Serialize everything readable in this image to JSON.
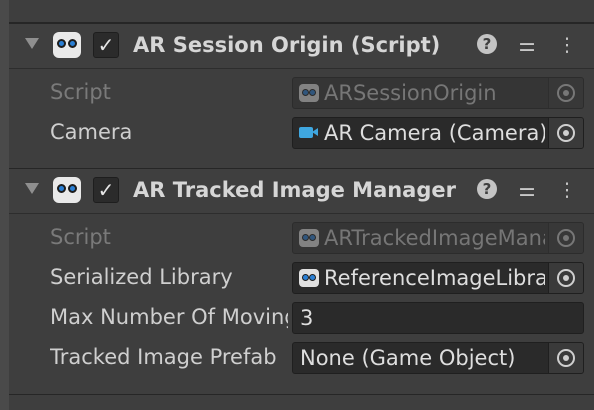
{
  "components": [
    {
      "title": "AR Session Origin (Script)",
      "enabled": true,
      "fields": [
        {
          "label": "Script",
          "value": "ARSessionOrigin",
          "disabled": true,
          "icon": "script-icon"
        },
        {
          "label": "Camera",
          "value": "AR Camera (Camera)",
          "disabled": false,
          "icon": "camera-icon"
        }
      ]
    },
    {
      "title": "AR Tracked Image Manager",
      "enabled": true,
      "fields": [
        {
          "label": "Script",
          "value": "ARTrackedImageManager",
          "disabled": true,
          "icon": "script-icon"
        },
        {
          "label": "Serialized Library",
          "value": "ReferenceImageLibrary",
          "disabled": false,
          "icon": "script-icon"
        },
        {
          "label": "Max Number Of Moving Images",
          "value": "3",
          "disabled": false,
          "icon": "none"
        },
        {
          "label": "Tracked Image Prefab",
          "value": "None (Game Object)",
          "disabled": false,
          "icon": "none"
        }
      ]
    }
  ],
  "icons": {
    "help": "?",
    "presets": "⚌",
    "menu": "⋮",
    "check": "✓"
  },
  "colors": {
    "background": "#3e3e3e",
    "field": "#2a2a2a",
    "accent_blue": "#2a7fd4"
  }
}
